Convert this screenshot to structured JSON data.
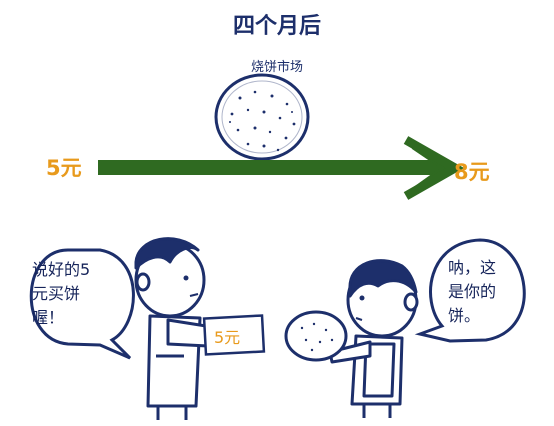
{
  "title": "四个月后",
  "market_label": "烧饼市场",
  "price_before": "5元",
  "price_after": "8元",
  "left_speech": [
    "说好的5",
    "元买饼",
    "喔！"
  ],
  "right_speech": [
    "呐，这",
    "是你的",
    "饼。"
  ],
  "banknote_label": "5元",
  "colors": {
    "arrow": "#2f6a21",
    "price": "#e89a1c",
    "ink": "#1d2f6b"
  }
}
